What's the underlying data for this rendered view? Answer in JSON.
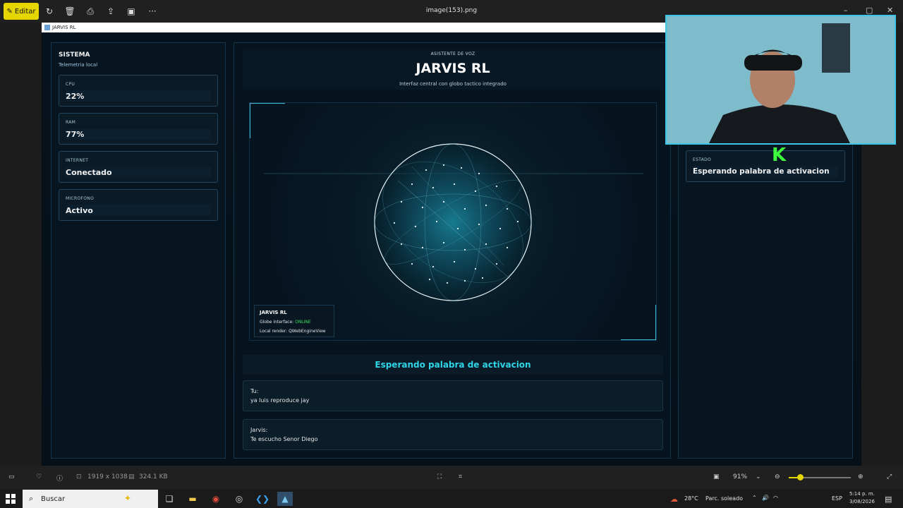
{
  "photos_app": {
    "edit_label": "Editar",
    "file_name": "image(153).png",
    "image_dims": "1919 x 1038",
    "file_size": "324.1 KB",
    "zoom": "91%",
    "zoom_fraction": 0.18,
    "icons": [
      "rotate-icon",
      "delete-icon",
      "print-icon",
      "share-icon",
      "slideshow-icon",
      "more-icon"
    ]
  },
  "jarvis_window": {
    "title": "JARVIS RL"
  },
  "sidebar": {
    "title": "SISTEMA",
    "subtitle": "Telemetria local",
    "stats": [
      {
        "label": "CPU",
        "value": "22%"
      },
      {
        "label": "RAM",
        "value": "77%"
      },
      {
        "label": "INTERNET",
        "value": "Conectado"
      },
      {
        "label": "MICROFONO",
        "value": "Activo"
      }
    ]
  },
  "header": {
    "kicker": "ASISTENTE DE VOZ",
    "title": "JARVIS RL",
    "subtitle": "Interfaz central con globo tactico integrado"
  },
  "globe_info": {
    "title": "JARVIS RL",
    "line1_prefix": "Globe interface: ",
    "line1_status": "ONLINE",
    "line2": "Local render: QWebEngineView"
  },
  "status_banner": "Esperando palabra de activacion",
  "messages": [
    {
      "who": "Tu:",
      "text": "ya luis reproduce jay"
    },
    {
      "who": "Jarvis:",
      "text": "Te escucho Senor Diego"
    }
  ],
  "right_panel": {
    "estado_label": "ESTADO",
    "estado_value": "Esperando palabra de activacion"
  },
  "overlay_badge": "K",
  "taskbar": {
    "search_placeholder": "Buscar",
    "weather": "28°C",
    "weather_desc": "Parc. soleado",
    "lang": "ESP",
    "time": "5:14 p. m.",
    "date": "3/08/2026"
  },
  "colors": {
    "accent_yellow": "#e6d600",
    "accent_cyan": "#2fd6e8",
    "online_green": "#3ee05a",
    "panel_bg": "#071521"
  }
}
